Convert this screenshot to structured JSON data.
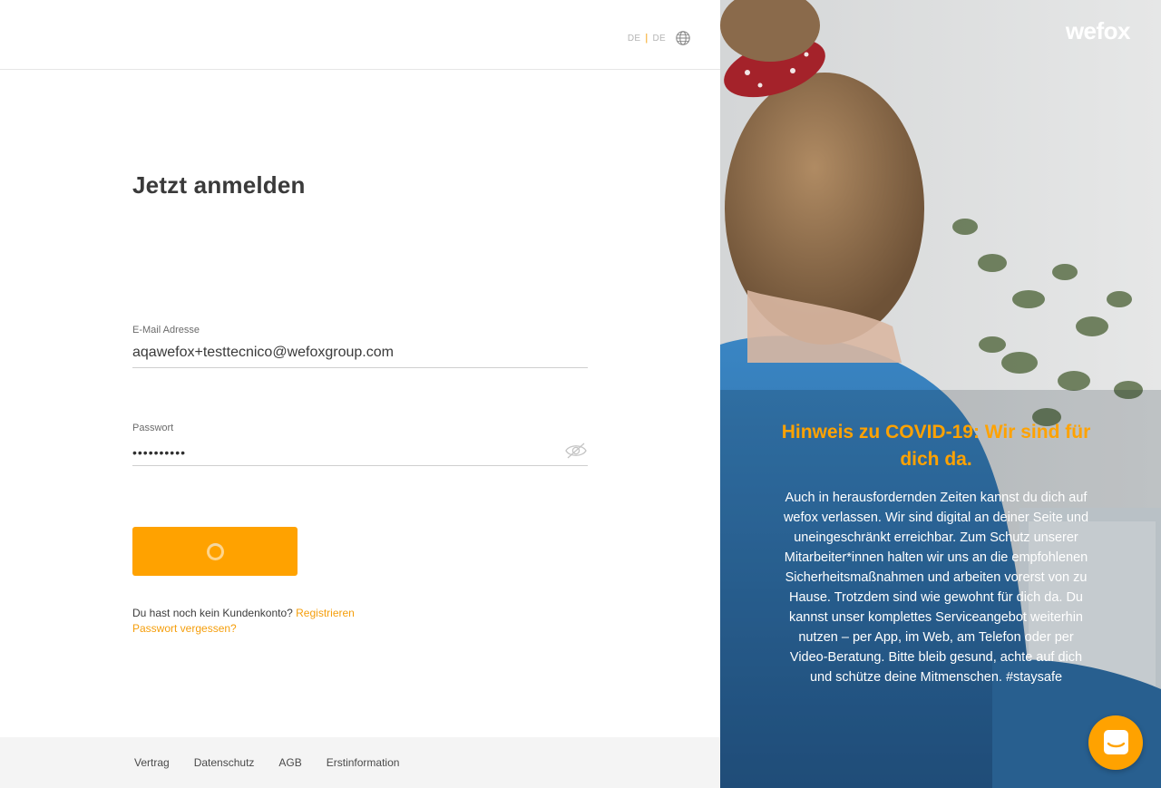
{
  "header": {
    "language_primary": "DE",
    "language_secondary": "DE",
    "globe_icon": "globe-icon"
  },
  "login": {
    "title": "Jetzt anmelden",
    "email_label": "E-Mail Adresse",
    "email_value": "aqawefox+testtecnico@wefoxgroup.com",
    "password_label": "Passwort",
    "password_masked": "••••••••••",
    "submit_state": "loading",
    "no_account_text": "Du hast noch kein Kundenkonto?",
    "register_link": "Registrieren",
    "forgot_password_link": "Passwort vergessen?"
  },
  "footer": {
    "items": [
      "Vertrag",
      "Datenschutz",
      "AGB",
      "Erstinformation"
    ]
  },
  "promo": {
    "brand": "wefox",
    "headline": "Hinweis zu COVID-19: Wir sind für dich da.",
    "body": "Auch in herausfordernden Zeiten kannst du dich auf wefox verlassen. Wir sind digital an deiner Seite und uneingeschränkt erreichbar. Zum Schutz unserer Mitarbeiter*innen halten wir uns an die empfohlenen Sicherheitsmaßnahmen und arbeiten vorerst von zu Hause. Trotzdem sind wie gewohnt für dich da. Du kannst unser komplettes Serviceangebot weiterhin nutzen – per App, im Web, am Telefon oder per Video-Beratung. Bitte bleib gesund, achte auf dich und schütze deine Mitmenschen. #staysafe"
  },
  "colors": {
    "accent": "#ffa200",
    "link": "#f59e0b",
    "text": "#3a3a3a",
    "footer_bg": "#f4f4f4"
  }
}
